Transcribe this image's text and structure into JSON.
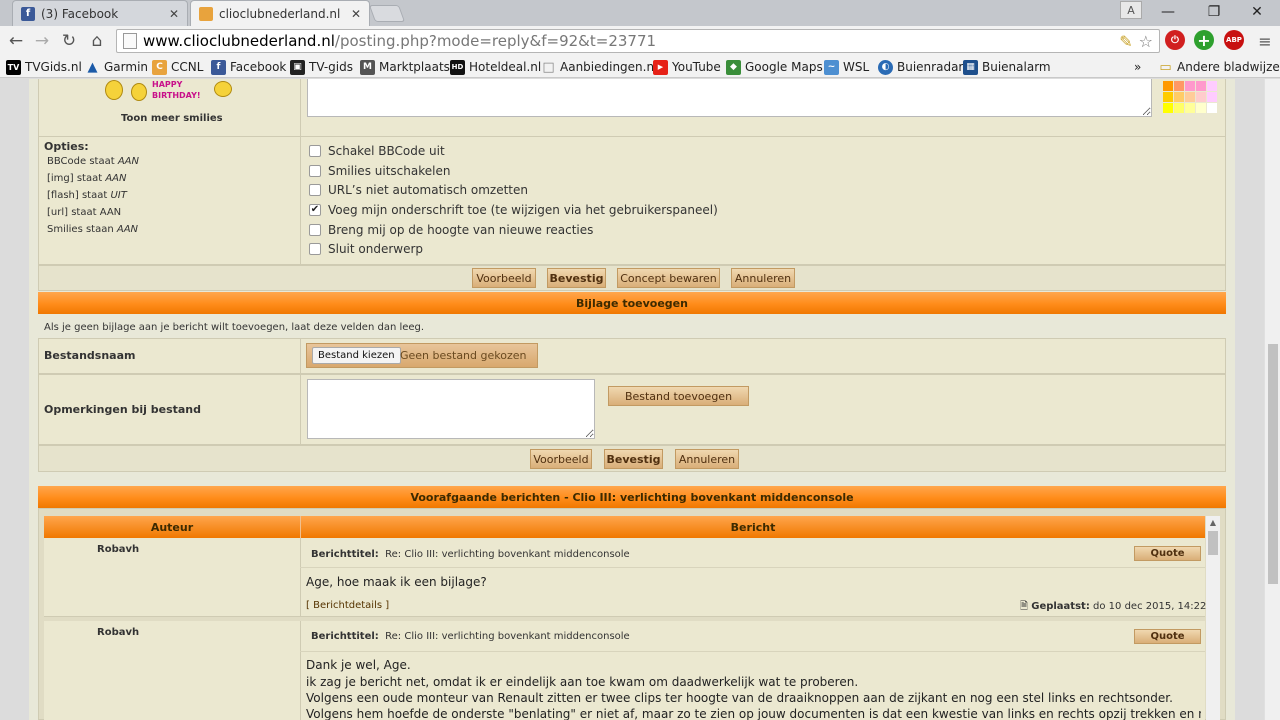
{
  "browser": {
    "tabs": [
      {
        "label": "(3) Facebook",
        "favicon": "f",
        "favicon_color": "#3b5998"
      },
      {
        "label": "clioclubnederland.nl • Pla",
        "favicon": "",
        "favicon_color": "#e8a33d"
      }
    ],
    "window_controls": [
      "—",
      "❐",
      "✕"
    ],
    "profile_letter": "A",
    "url_host": "www.clioclubnederland.nl",
    "url_path": "/posting.php?mode=reply&f=92&t=23771",
    "extensions": [
      {
        "name": "stop-extension",
        "glyph": "⏻",
        "color": "#d11f1f"
      },
      {
        "name": "plus-extension",
        "glyph": "+",
        "color": "#2ea02e"
      },
      {
        "name": "adblock-extension",
        "glyph": "ABP",
        "color": "#c81010"
      }
    ],
    "bookmarks": [
      {
        "label": "TVGids.nl",
        "icon": "TV",
        "color": "#000000"
      },
      {
        "label": "Garmin",
        "icon": "▲",
        "color": "#1b5aa8"
      },
      {
        "label": "CCNL",
        "icon": "C",
        "color": "#e8a33d"
      },
      {
        "label": "Facebook",
        "icon": "f",
        "color": "#3b5998"
      },
      {
        "label": "TV-gids",
        "icon": "▣",
        "color": "#222222"
      },
      {
        "label": "Marktplaats",
        "icon": "M",
        "color": "#545454"
      },
      {
        "label": "Hoteldeal.nl",
        "icon": "HD",
        "color": "#111111"
      },
      {
        "label": "Aanbiedingen.nl",
        "icon": "□",
        "color": "#9a9a9a"
      },
      {
        "label": "YouTube",
        "icon": "▶",
        "color": "#e62117"
      },
      {
        "label": "Google Maps",
        "icon": "◆",
        "color": "#3a8e3a"
      },
      {
        "label": "WSL",
        "icon": "~",
        "color": "#4d8fd1"
      },
      {
        "label": "Buienradar",
        "icon": "◐",
        "color": "#2a6bb5"
      },
      {
        "label": "Buienalarm",
        "icon": "▦",
        "color": "#1e4f8c"
      }
    ],
    "bookmarks_more": "»",
    "other_bookmarks": "Andere bladwijzers"
  },
  "smilies": {
    "more_label": "Toon meer smilies",
    "birthday_text": "HAPPY BIRTHDAY!"
  },
  "options": {
    "title": "Opties:",
    "status": [
      {
        "text": "BBCode staat ",
        "value": "AAN"
      },
      {
        "text": "[img] staat ",
        "value": "AAN"
      },
      {
        "text": "[flash] staat ",
        "value": "UIT"
      },
      {
        "text": "[url] staat AAN",
        "value": ""
      },
      {
        "text": "Smilies staan ",
        "value": "AAN"
      }
    ],
    "checkboxes": [
      {
        "label": "Schakel BBCode uit",
        "checked": false
      },
      {
        "label": "Smilies uitschakelen",
        "checked": false
      },
      {
        "label": "URL’s niet automatisch omzetten",
        "checked": false
      },
      {
        "label": "Voeg mijn onderschrift toe (te wijzigen via het gebruikerspaneel)",
        "checked": true
      },
      {
        "label": "Breng mij op de hoogte van nieuwe reacties",
        "checked": false
      },
      {
        "label": "Sluit onderwerp",
        "checked": false
      }
    ]
  },
  "form_buttons": {
    "preview": "Voorbeeld",
    "submit": "Bevestig",
    "draft": "Concept bewaren",
    "cancel": "Annuleren"
  },
  "attachment": {
    "header": "Bijlage toevoegen",
    "hint": "Als je geen bijlage aan je bericht wilt toevoegen, laat deze velden dan leeg.",
    "filename_label": "Bestandsnaam",
    "choose_button": "Bestand kiezen",
    "no_file": "Geen bestand gekozen",
    "comment_label": "Opmerkingen bij bestand",
    "add_button": "Bestand toevoegen",
    "preview": "Voorbeeld",
    "submit": "Bevestig",
    "cancel": "Annuleren"
  },
  "previous": {
    "header": "Voorafgaande berichten - Clio III: verlichting bovenkant middenconsole",
    "col_author": "Auteur",
    "col_message": "Bericht",
    "posts": [
      {
        "author": "Robavh",
        "subject_label": "Berichttitel:",
        "subject": "Re: Clio III: verlichting bovenkant middenconsole",
        "quote": "Quote",
        "lines": [
          "Age, hoe maak ik een bijlage?"
        ],
        "details": "[ Berichtdetails ]",
        "posted_label": "Geplaatst:",
        "posted": "do 10 dec 2015, 14:22"
      },
      {
        "author": "Robavh",
        "subject_label": "Berichttitel:",
        "subject": "Re: Clio III: verlichting bovenkant middenconsole",
        "quote": "Quote",
        "lines": [
          "Dank je wel, Age.",
          "ik zag je bericht net, omdat ik er eindelijk aan toe kwam om daadwerkelijk wat te proberen.",
          "Volgens een oude monteur van Renault zitten er twee clips ter hoogte van de draaiknoppen aan de zijkant en nog een stel links en rechtsonder.",
          "Volgens hem hoefde de onderste \"benlating\" er niet af, maar zo te zien op jouw documenten is dat een kwestie van links en rechts opzij trekken en naar achteren"
        ]
      }
    ]
  },
  "colors": {
    "accent_orange": "#ff8c1a",
    "panel_beige": "#ebe8d0",
    "button_brown": "#d9ae78"
  }
}
